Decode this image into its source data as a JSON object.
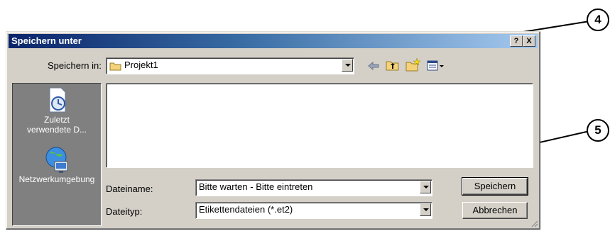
{
  "dialog": {
    "title": "Speichern unter",
    "help_label": "?",
    "close_label": "X"
  },
  "save_in": {
    "label": "Speichern in:",
    "value": "Projekt1"
  },
  "places": [
    {
      "label": "Zuletzt verwendete D...",
      "icon": "recent-documents-icon"
    },
    {
      "label": "Netzwerkumgebung",
      "icon": "network-places-icon"
    }
  ],
  "filename": {
    "label": "Dateiname:",
    "value": "Bitte warten - Bitte eintreten"
  },
  "filetype": {
    "label": "Dateityp:",
    "value": "Etikettendateien  (*.et2)"
  },
  "buttons": {
    "save": "Speichern",
    "cancel": "Abbrechen"
  },
  "callouts": [
    "4",
    "5"
  ],
  "toolbar": {
    "icons": [
      "back-arrow-icon",
      "up-folder-icon",
      "new-folder-icon",
      "view-menu-icon"
    ]
  },
  "colors": {
    "titlebar_start": "#0a246a",
    "titlebar_end": "#a6caf0",
    "dialog_bg": "#d4d0c8",
    "places_bg": "#808080"
  }
}
